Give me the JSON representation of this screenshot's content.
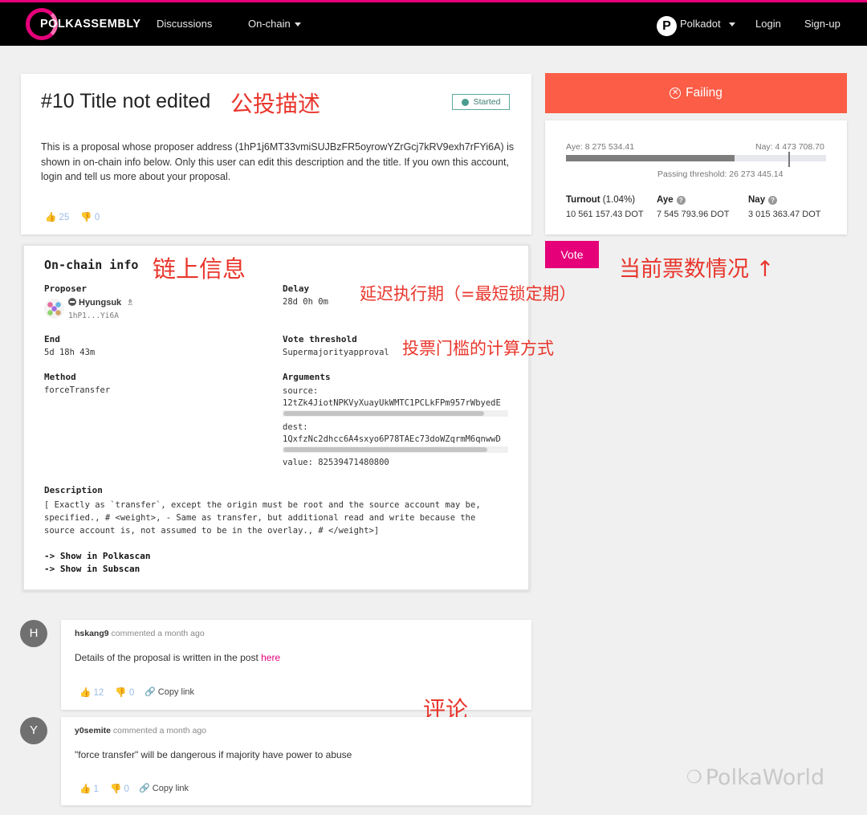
{
  "nav": {
    "logo": "POLKASSEMBLY",
    "discussions": "Discussions",
    "onchain": "On-chain",
    "network": "Polkadot",
    "network_logo": "P",
    "login": "Login",
    "signup": "Sign-up"
  },
  "proposal": {
    "title": "#10 Title not edited",
    "status": "Started",
    "description": "This is a proposal whose proposer address (1hP1j6MT33vmiSUJBzFR5oyrowYZrGcj7kRV9exh7rFYi6A) is shown in on-chain info below. Only this user can edit this description and the title. If you own this account, login and tell us more about your proposal.",
    "likes": "25",
    "dislikes": "0"
  },
  "annotations": {
    "title": "公投描述",
    "onchain": "链上信息",
    "delay": "延迟执行期（=最短锁定期）",
    "threshold": "投票门槛的计算方式",
    "votes": "当前票数情况 ↑",
    "comments": "评论"
  },
  "onchain": {
    "heading": "On-chain info",
    "proposer_label": "Proposer",
    "proposer_name": "Hyungsuk",
    "proposer_address": "1hP1...Yi6A",
    "delay_label": "Delay",
    "delay_value": "28d 0h 0m",
    "end_label": "End",
    "end_value": "5d 18h 43m",
    "threshold_label": "Vote threshold",
    "threshold_value": "Supermajorityapproval",
    "method_label": "Method",
    "method_value": "forceTransfer",
    "arguments_label": "Arguments",
    "source_label": "source:",
    "source_value": "12tZk4JiotNPKVyXuayUkWMTC1PCLkFPm957rWbyedE",
    "dest_label": "dest:",
    "dest_value": "1QxfzNc2dhcc6A4sxyo6P78TAEc73doWZqrmM6qnwwD",
    "value_line": "value: 82539471480800",
    "description_label": "Description",
    "description_text": "[ Exactly as `transfer`, except the origin must be root and the source account may be, specified., # <weight>, - Same as transfer, but additional read and write because the source account is, not assumed to be in the overlay., # </weight>]",
    "polkascan_link": "-> Show in Polkascan",
    "subscan_link": "-> Show in Subscan"
  },
  "voting": {
    "status": "Failing",
    "aye_summary": "Aye: 8 275 534.41",
    "nay_summary": "Nay: 4 473 708.70",
    "passing_threshold": "Passing threshold: 26 273 445.14",
    "aye_fraction": 0.649,
    "turnout_label": "Turnout",
    "turnout_pct": "(1.04%)",
    "turnout_value": "10 561 157.43 DOT",
    "aye_label": "Aye",
    "aye_value": "7 545 793.96 DOT",
    "nay_label": "Nay",
    "nay_value": "3 015 363.47 DOT",
    "vote_button": "Vote"
  },
  "comments": [
    {
      "initial": "H",
      "author": "hskang9",
      "meta": "commented a month ago",
      "text": "Details of the proposal is written in the post ",
      "link": "here",
      "likes": "12",
      "dislikes": "0",
      "copy": "Copy link"
    },
    {
      "initial": "Y",
      "author": "y0semite",
      "meta": "commented a month ago",
      "text": "\"force transfer\" will be dangerous if majority have power to abuse",
      "likes": "1",
      "dislikes": "0",
      "copy": "Copy link"
    }
  ],
  "watermark": "PolkaWorld",
  "colors": {
    "brand": "#e5007a",
    "failing": "#fb5d47",
    "started": "#4a9d8f",
    "annotation": "#e8362c"
  }
}
